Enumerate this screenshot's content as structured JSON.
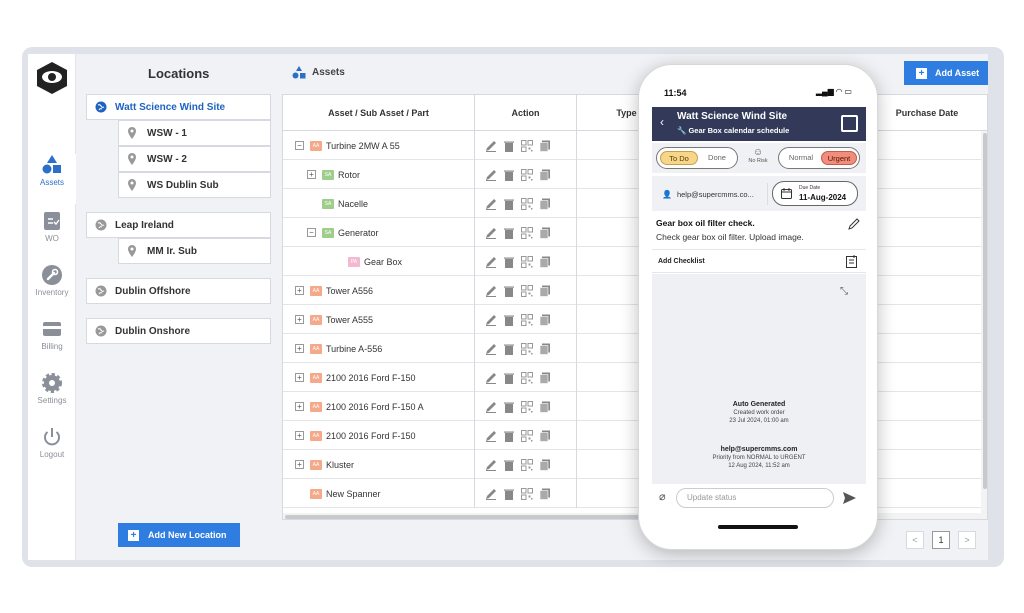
{
  "nav": {
    "items": [
      {
        "label": "Assets",
        "icon": "shapes-icon"
      },
      {
        "label": "WO",
        "icon": "clipboard-icon"
      },
      {
        "label": "Inventory",
        "icon": "wrench-icon"
      },
      {
        "label": "Billing",
        "icon": "card-icon"
      },
      {
        "label": "Settings",
        "icon": "gear-icon"
      },
      {
        "label": "Logout",
        "icon": "power-icon"
      }
    ]
  },
  "locations": {
    "title": "Locations",
    "sites": [
      {
        "name": "Watt Science Wind Site",
        "subs": [
          "WSW - 1",
          "WSW - 2",
          "WS Dublin Sub"
        ]
      },
      {
        "name": "Leap Ireland",
        "subs": [
          "MM Ir. Sub"
        ]
      },
      {
        "name": "Dublin Offshore",
        "subs": []
      },
      {
        "name": "Dublin Onshore",
        "subs": []
      }
    ],
    "add_button": "Add New Location"
  },
  "assets": {
    "title": "Assets",
    "add_button": "Add Asset",
    "columns": [
      "Asset / Sub Asset / Part",
      "Action",
      "Type",
      "Purchase Date"
    ],
    "rows": [
      {
        "name": "Turbine 2MW A 55",
        "badge": "AA",
        "toggle": "−",
        "level": 0
      },
      {
        "name": "Rotor",
        "badge": "SA",
        "toggle": "+",
        "level": 1
      },
      {
        "name": "Nacelle",
        "badge": "SA",
        "toggle": "",
        "level": 1
      },
      {
        "name": "Generator",
        "badge": "SA",
        "toggle": "−",
        "level": 1
      },
      {
        "name": "Gear Box",
        "badge": "PA",
        "toggle": "",
        "level": 2
      },
      {
        "name": "Tower A556",
        "badge": "AA",
        "toggle": "+",
        "level": 0
      },
      {
        "name": "Tower A555",
        "badge": "AA",
        "toggle": "+",
        "level": 0
      },
      {
        "name": "Turbine A-556",
        "badge": "AA",
        "toggle": "+",
        "level": 0
      },
      {
        "name": "2100 2016 Ford F-150",
        "badge": "AA",
        "toggle": "+",
        "level": 0
      },
      {
        "name": "2100 2016 Ford F-150 A",
        "badge": "AA",
        "toggle": "+",
        "level": 0
      },
      {
        "name": "2100 2016 Ford F-150",
        "badge": "AA",
        "toggle": "+",
        "level": 0
      },
      {
        "name": "Kluster",
        "badge": "AA",
        "toggle": "+",
        "level": 0
      },
      {
        "name": "New Spanner",
        "badge": "AA",
        "toggle": "",
        "level": 0
      }
    ],
    "pager": {
      "prev": "<",
      "current": "1",
      "next": ">"
    }
  },
  "phone": {
    "time": "11:54",
    "header_title": "Watt Science Wind Site",
    "header_subtitle": "Gear Box calendar schedule",
    "status_options": [
      "To Do",
      "Done"
    ],
    "risk_label": "No Risk",
    "priority_options": [
      "Normal",
      "Urgent"
    ],
    "email": "help@supercmms.co...",
    "due_label": "Due Date",
    "due_value": "11-Aug-2024",
    "task_title": "Gear box oil filter check.",
    "task_desc": "Check gear box oil filter. Upload image.",
    "add_checklist": "Add Checklist",
    "logs": [
      {
        "a": "Auto Generated",
        "b": "Created work order",
        "c": "23 Jul 2024, 01:00 am"
      },
      {
        "a": "help@supercmms.com",
        "b": "Priority from NORMAL to URGENT",
        "c": "12 Aug 2024, 11:52 am"
      }
    ],
    "input_placeholder": "Update status",
    "colors": {
      "todo": "#f7d58b",
      "urgent": "#f08e7e",
      "header": "#333a59"
    }
  }
}
